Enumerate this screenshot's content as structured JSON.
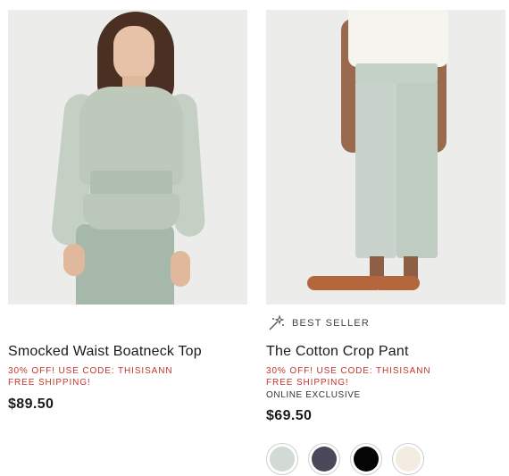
{
  "products": [
    {
      "title": "Smocked Waist Boatneck Top",
      "promo_line_1": "30% OFF! USE CODE: THISISANN",
      "promo_line_2": "FREE SHIPPING!",
      "price": "$89.50"
    },
    {
      "badge_icon": "sparkle-wand-icon",
      "badge": "BEST SELLER",
      "title": "The Cotton Crop Pant",
      "promo_line_1": "30% OFF! USE CODE: THISISANN",
      "promo_line_2": "FREE SHIPPING!",
      "exclusive": "ONLINE EXCLUSIVE",
      "price": "$69.50",
      "swatches": [
        {
          "color": "#d2dbd3"
        },
        {
          "color": "#4a4859"
        },
        {
          "color": "#050505"
        },
        {
          "color": "#f3ece1"
        }
      ]
    }
  ],
  "colors": {
    "promo": "#c2372c",
    "text": "#1a1a1a",
    "photo_bg": "#ececea"
  }
}
